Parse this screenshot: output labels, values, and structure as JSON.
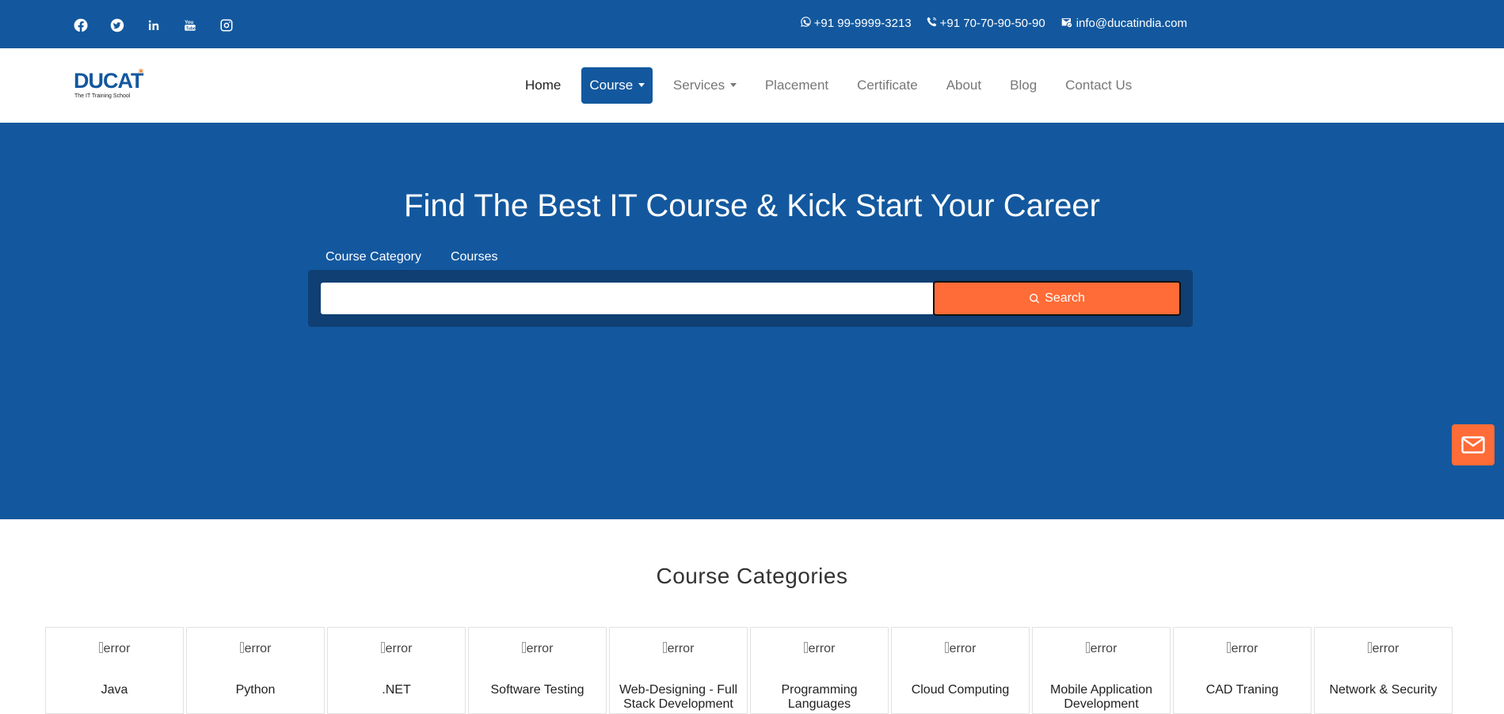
{
  "topbar": {
    "social": [
      {
        "icon": "facebook-icon"
      },
      {
        "icon": "twitter-icon"
      },
      {
        "icon": "linkedin-icon"
      },
      {
        "icon": "youtube-icon"
      },
      {
        "icon": "instagram-icon"
      }
    ],
    "whatsapp": "+91 99-9999-3213",
    "phone": "+91 70-70-90-50-90",
    "email": "info@ducatindia.com"
  },
  "brand": {
    "name": "DUCAT",
    "tagline": "The IT Training School"
  },
  "nav": {
    "home": "Home",
    "course": "Course",
    "services": "Services",
    "placement": "Placement",
    "certificate": "Certificate",
    "about": "About",
    "blog": "Blog",
    "contact": "Contact Us"
  },
  "hero": {
    "title": "Find The Best IT Course & Kick Start Your Career",
    "tab_category": "Course Category",
    "tab_courses": "Courses",
    "search_value": "",
    "search_button": "Search"
  },
  "categories": {
    "title": "Course Categories",
    "image_alt": "error",
    "items": [
      "Java",
      "Python",
      ".NET",
      "Software Testing",
      "Web-Designing - Full Stack Development",
      "Programming Languages",
      "Cloud Computing",
      "Mobile Application Development",
      "CAD Traning",
      "Network & Security"
    ]
  },
  "colors": {
    "brand_blue": "#13589e",
    "accent_orange": "#ff6c37"
  }
}
